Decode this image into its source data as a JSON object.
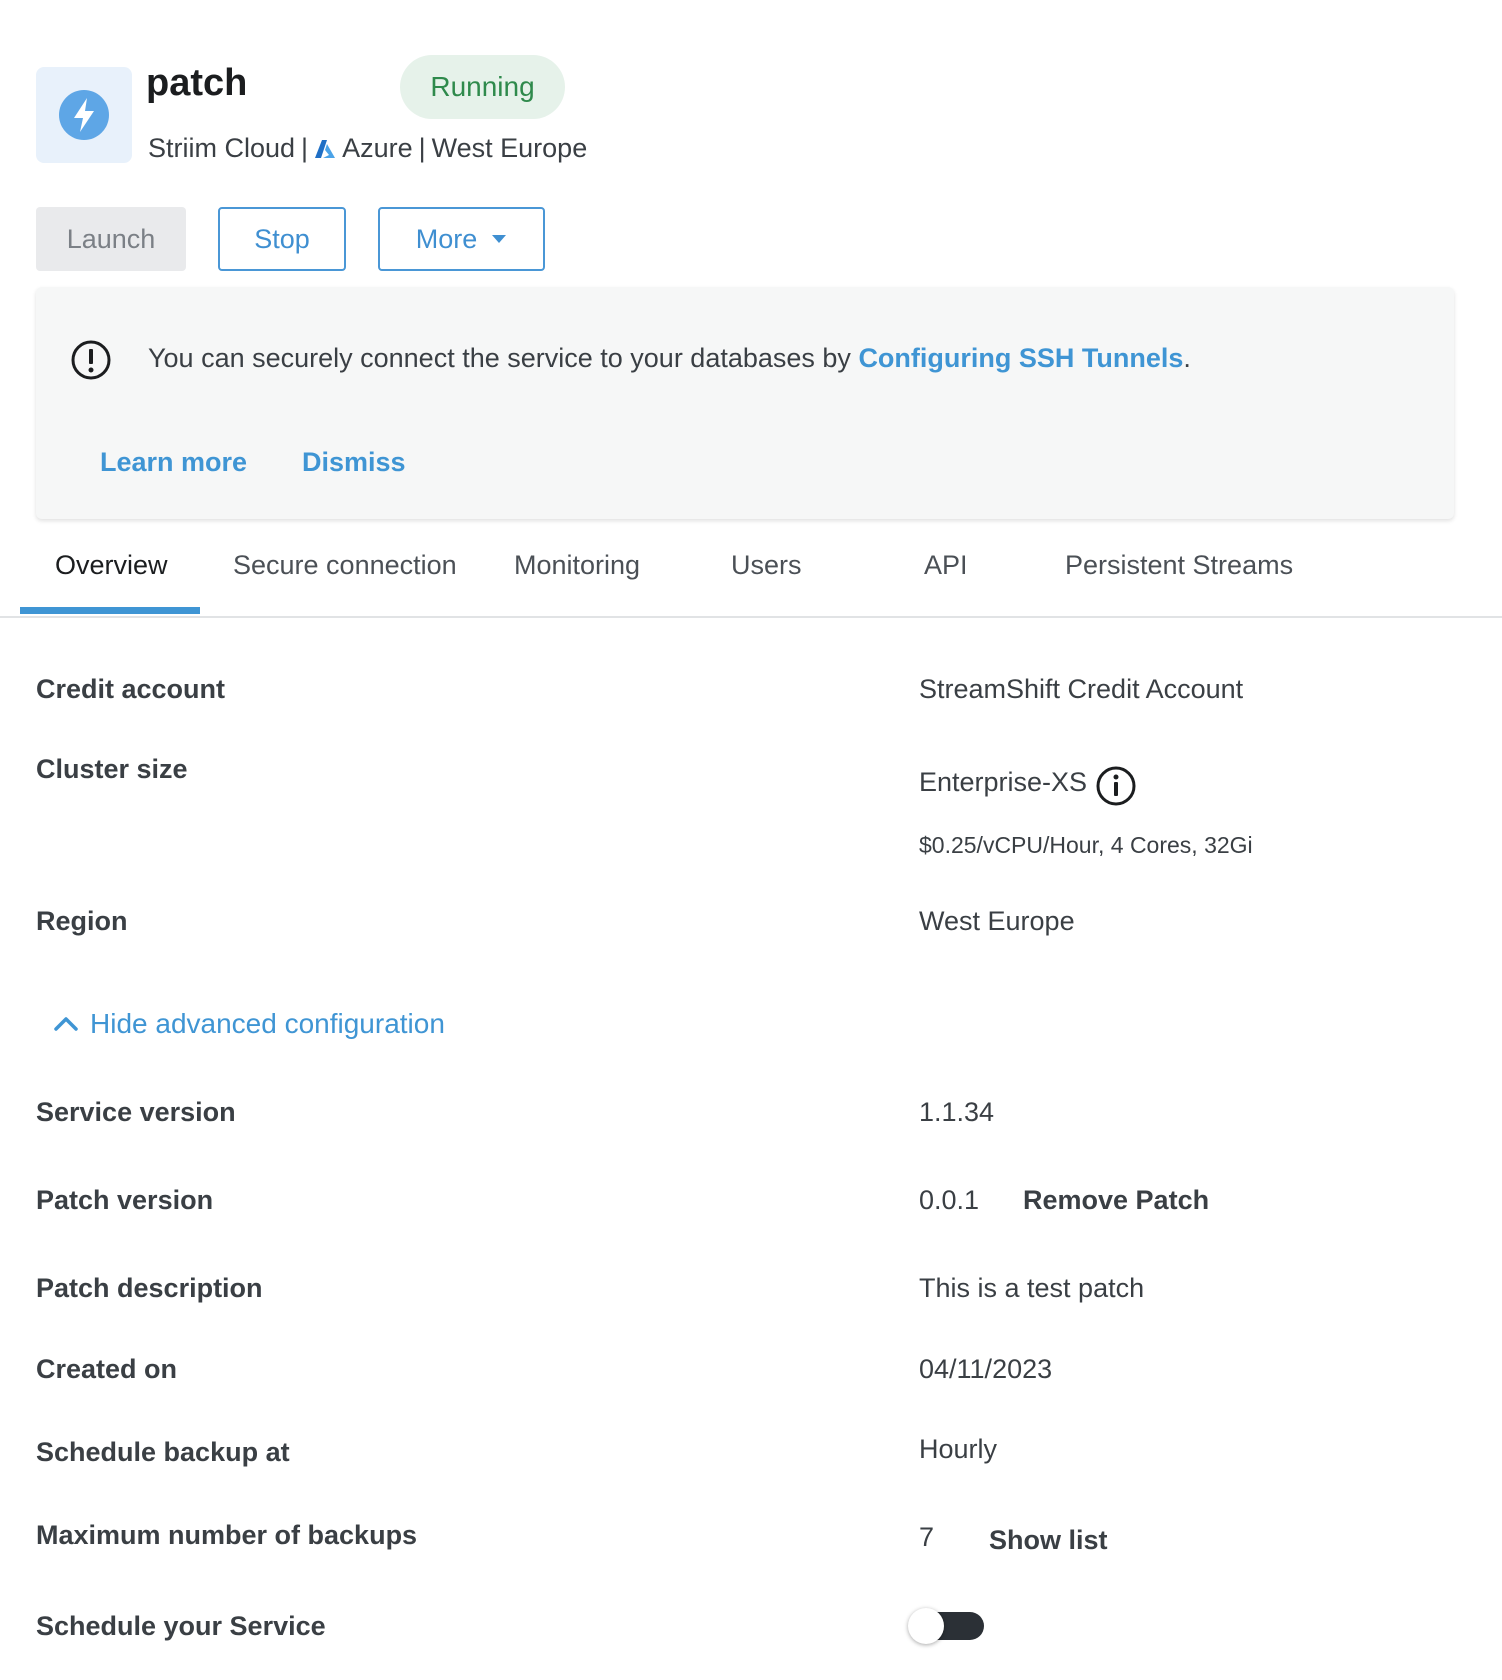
{
  "header": {
    "service_name": "patch",
    "status": "Running",
    "platform": "Striim Cloud",
    "separator": "|",
    "cloud": "Azure",
    "region": "West Europe",
    "service_icon": "lightning-bolt-icon",
    "cloud_icon": "azure-logo-icon"
  },
  "actions": {
    "launch_label": "Launch",
    "stop_label": "Stop",
    "more_label": "More"
  },
  "banner": {
    "message_prefix": "You can securely connect the service to your databases by ",
    "message_link": "Configuring SSH Tunnels",
    "message_suffix": ".",
    "learn_more": "Learn more",
    "dismiss": "Dismiss",
    "icon": "exclamation-circle-icon"
  },
  "tabs": [
    {
      "label": "Overview",
      "active": true
    },
    {
      "label": "Secure connection"
    },
    {
      "label": "Monitoring"
    },
    {
      "label": "Users"
    },
    {
      "label": "API"
    },
    {
      "label": "Persistent Streams"
    }
  ],
  "details": {
    "credit_account": {
      "label": "Credit account",
      "value": "StreamShift Credit Account"
    },
    "cluster_size": {
      "label": "Cluster size",
      "value": "Enterprise-XS",
      "pricing": "$0.25/vCPU/Hour, 4 Cores, 32Gi"
    },
    "region": {
      "label": "Region",
      "value": "West Europe"
    },
    "advanced_toggle": "Hide advanced configuration",
    "service_version": {
      "label": "Service version",
      "value": "1.1.34"
    },
    "patch_version": {
      "label": "Patch version",
      "value": "0.0.1",
      "action": "Remove Patch"
    },
    "patch_description": {
      "label": "Patch description",
      "value": "This is a test patch"
    },
    "created_on": {
      "label": "Created on",
      "value": "04/11/2023"
    },
    "schedule_backup": {
      "label": "Schedule backup at",
      "value": "Hourly"
    },
    "max_backups": {
      "label": "Maximum number of backups",
      "value": "7",
      "action": "Show list"
    },
    "schedule_service": {
      "label": "Schedule your Service",
      "enabled": false
    }
  },
  "colors": {
    "accent": "#3f95d4",
    "status_green": "#2f8a4c",
    "status_bg": "#e6f2ea"
  }
}
